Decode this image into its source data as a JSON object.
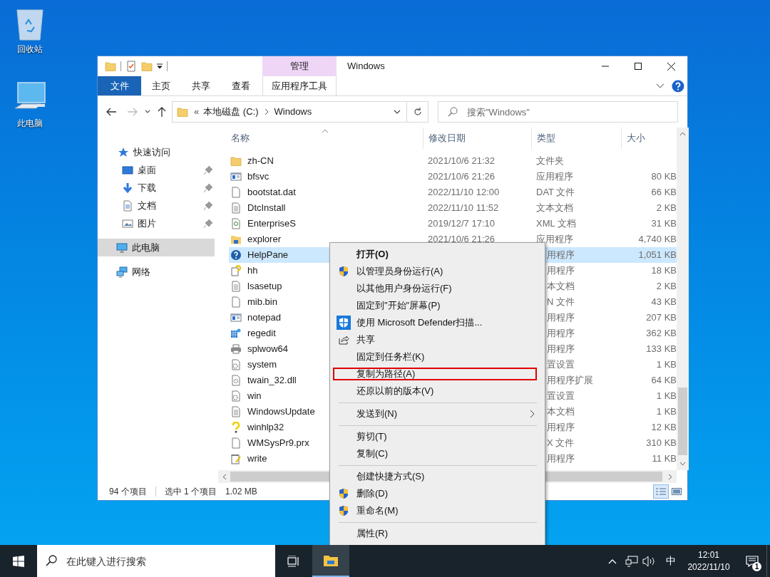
{
  "desktop_icons": [
    {
      "label": "回收站",
      "kind": "recycle"
    },
    {
      "label": "此电脑",
      "kind": "pc"
    }
  ],
  "window": {
    "title": "Windows",
    "contextual_group": "管理",
    "ribbon_tabs": [
      {
        "label": "文件",
        "kind": "file",
        "selected": false
      },
      {
        "label": "主页",
        "kind": "normal",
        "selected": false
      },
      {
        "label": "共享",
        "kind": "normal",
        "selected": false
      },
      {
        "label": "查看",
        "kind": "normal",
        "selected": false
      },
      {
        "label": "应用程序工具",
        "kind": "contextual",
        "selected": false
      }
    ],
    "address": {
      "overflow": "«",
      "segments": [
        "本地磁盘 (C:)",
        "Windows"
      ]
    },
    "search": {
      "placeholder": "搜索\"Windows\""
    },
    "nav_pane": [
      {
        "label": "快速访问",
        "kind": "star",
        "selected": false,
        "children": [
          {
            "label": "桌面",
            "kind": "desktop",
            "pinned": true,
            "selected": false
          },
          {
            "label": "下载",
            "kind": "download",
            "pinned": true,
            "selected": false
          },
          {
            "label": "文档",
            "kind": "document",
            "pinned": true,
            "selected": false
          },
          {
            "label": "图片",
            "kind": "picture",
            "pinned": true,
            "selected": false
          }
        ]
      },
      {
        "label": "此电脑",
        "kind": "pc",
        "selected": true
      },
      {
        "label": "网络",
        "kind": "network",
        "selected": false
      }
    ],
    "file_list": {
      "columns": [
        "名称",
        "修改日期",
        "类型",
        "大小"
      ],
      "rows": [
        {
          "name": "zh-CN",
          "kind": "folder",
          "date": "2021/10/6 21:32",
          "type": "文件夹",
          "selected": false
        },
        {
          "name": "bfsvc",
          "kind": "app",
          "date": "2021/10/6 21:26",
          "type": "应用程序",
          "size": "80 KB",
          "selected": false
        },
        {
          "name": "bootstat.dat",
          "kind": "blank",
          "date": "2022/11/10 12:00",
          "type": "DAT 文件",
          "size": "66 KB",
          "selected": false
        },
        {
          "name": "DtcInstall",
          "kind": "text",
          "date": "2022/11/10 11:52",
          "type": "文本文档",
          "size": "2 KB",
          "selected": false
        },
        {
          "name": "EnterpriseS",
          "kind": "xml",
          "date": "2019/12/7 17:10",
          "type": "XML 文档",
          "size": "31 KB",
          "selected": false
        },
        {
          "name": "explorer",
          "kind": "explorer",
          "date": "2021/10/6 21:26",
          "type": "应用程序",
          "size": "4,740 KB",
          "selected": false
        },
        {
          "name": "HelpPane",
          "kind": "help",
          "type": "用程序",
          "size": "1,051 KB",
          "selected": true
        },
        {
          "name": "hh",
          "kind": "helpfile",
          "type": "用程序",
          "size": "18 KB",
          "selected": false
        },
        {
          "name": "lsasetup",
          "kind": "text",
          "type": "本文档",
          "size": "2 KB",
          "selected": false
        },
        {
          "name": "mib.bin",
          "kind": "blank",
          "type": "N 文件",
          "size": "43 KB",
          "selected": false
        },
        {
          "name": "notepad",
          "kind": "app",
          "type": "用程序",
          "size": "207 KB",
          "selected": false
        },
        {
          "name": "regedit",
          "kind": "regedit",
          "type": "用程序",
          "size": "362 KB",
          "selected": false
        },
        {
          "name": "splwow64",
          "kind": "printer",
          "type": "用程序",
          "size": "133 KB",
          "selected": false
        },
        {
          "name": "system",
          "kind": "settings",
          "type": "置设置",
          "size": "1 KB",
          "selected": false
        },
        {
          "name": "twain_32.dll",
          "kind": "dll",
          "type": "用程序扩展",
          "size": "64 KB",
          "selected": false
        },
        {
          "name": "win",
          "kind": "settings",
          "type": "置设置",
          "size": "1 KB",
          "selected": false
        },
        {
          "name": "WindowsUpdate",
          "kind": "text",
          "type": "本文档",
          "size": "1 KB",
          "selected": false
        },
        {
          "name": "winhlp32",
          "kind": "question",
          "type": "用程序",
          "size": "12 KB",
          "selected": false
        },
        {
          "name": "WMSysPr9.prx",
          "kind": "blank",
          "type": "X 文件",
          "size": "310 KB",
          "selected": false
        },
        {
          "name": "write",
          "kind": "write",
          "type": "用程序",
          "size": "11 KB",
          "selected": false
        }
      ]
    },
    "status_bar": {
      "item_count": "94 个项目",
      "selection": "选中 1 个项目",
      "selection_size": "1.02 MB"
    }
  },
  "context_menu": [
    {
      "kind": "item",
      "label": "打开(O)",
      "default": true,
      "submenu": false,
      "highlighted": false
    },
    {
      "kind": "shield_item",
      "label": "以管理员身份运行(A)",
      "default": false,
      "submenu": false,
      "highlighted": false
    },
    {
      "kind": "item",
      "label": "以其他用户身份运行(F)",
      "default": false,
      "submenu": false,
      "highlighted": false
    },
    {
      "kind": "item",
      "label": "固定到\"开始\"屏幕(P)",
      "default": false,
      "submenu": false,
      "highlighted": false
    },
    {
      "kind": "defender_item",
      "label": "使用 Microsoft Defender扫描...",
      "default": false,
      "submenu": false,
      "highlighted": false
    },
    {
      "kind": "share_item",
      "label": "共享",
      "default": false,
      "submenu": false,
      "highlighted": false
    },
    {
      "kind": "item",
      "label": "固定到任务栏(K)",
      "default": false,
      "submenu": false,
      "highlighted": false
    },
    {
      "kind": "item",
      "label": "复制为路径(A)",
      "default": false,
      "submenu": false,
      "highlighted": true
    },
    {
      "kind": "item",
      "label": "还原以前的版本(V)",
      "default": false,
      "submenu": false,
      "highlighted": false
    },
    {
      "kind": "separator"
    },
    {
      "kind": "item",
      "label": "发送到(N)",
      "default": false,
      "submenu": true,
      "highlighted": false
    },
    {
      "kind": "separator"
    },
    {
      "kind": "item",
      "label": "剪切(T)",
      "default": false,
      "submenu": false,
      "highlighted": false
    },
    {
      "kind": "item",
      "label": "复制(C)",
      "default": false,
      "submenu": false,
      "highlighted": false
    },
    {
      "kind": "separator"
    },
    {
      "kind": "item",
      "label": "创建快捷方式(S)",
      "default": false,
      "submenu": false,
      "highlighted": false
    },
    {
      "kind": "shield_item",
      "label": "删除(D)",
      "default": false,
      "submenu": false,
      "highlighted": false
    },
    {
      "kind": "shield_item",
      "label": "重命名(M)",
      "default": false,
      "submenu": false,
      "highlighted": false
    },
    {
      "kind": "separator"
    },
    {
      "kind": "item",
      "label": "属性(R)",
      "default": false,
      "submenu": false,
      "highlighted": false
    }
  ],
  "taskbar": {
    "search_placeholder": "在此键入进行搜索",
    "ime": "中",
    "time": "12:01",
    "date": "2022/11/10",
    "notification_count": "1"
  }
}
